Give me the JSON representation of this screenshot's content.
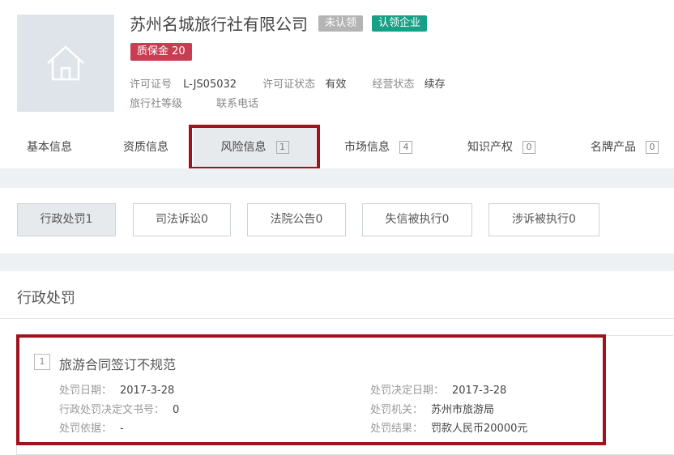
{
  "company": {
    "name": "苏州名城旅行社有限公司",
    "tags": {
      "unclaimed": "未认领",
      "claim": "认领企业",
      "deposit": "质保金 20"
    },
    "license_no_label": "许可证号",
    "license_no": "L-JS05032",
    "license_status_label": "许可证状态",
    "license_status": "有效",
    "business_status_label": "经营状态",
    "business_status": "续存",
    "level_label": "旅行社等级",
    "phone_label": "联系电话"
  },
  "tabs": [
    {
      "label": "基本信息"
    },
    {
      "label": "资质信息"
    },
    {
      "label": "风险信息",
      "count": "1",
      "active": true
    },
    {
      "label": "市场信息",
      "count": "4"
    },
    {
      "label": "知识产权",
      "count": "0"
    },
    {
      "label": "名牌产品",
      "count": "0"
    }
  ],
  "filters": [
    {
      "label": "行政处罚1",
      "active": true
    },
    {
      "label": "司法诉讼0"
    },
    {
      "label": "法院公告0"
    },
    {
      "label": "失信被执行0"
    },
    {
      "label": "涉诉被执行0"
    }
  ],
  "section": {
    "title": "行政处罚"
  },
  "record": {
    "index": "1",
    "title": "旅游合同签订不规范",
    "left": [
      {
        "label": "处罚日期：",
        "value": "2017-3-28"
      },
      {
        "label": "行政处罚决定文书号：",
        "value": "0"
      },
      {
        "label": "处罚依据：",
        "value": "-"
      }
    ],
    "right": [
      {
        "label": "处罚决定日期：",
        "value": "2017-3-28"
      },
      {
        "label": "处罚机关：",
        "value": "苏州市旅游局"
      },
      {
        "label": "处罚结果：",
        "value": "罚款人民币20000元"
      }
    ]
  },
  "colors": {
    "highlight": "#a0121c",
    "claim_tag": "#16a086",
    "deposit_tag": "#c93d52",
    "unclaimed_tag": "#b4b4b4",
    "band": "#eef1f4"
  },
  "icons": {
    "logo": "home-icon"
  }
}
